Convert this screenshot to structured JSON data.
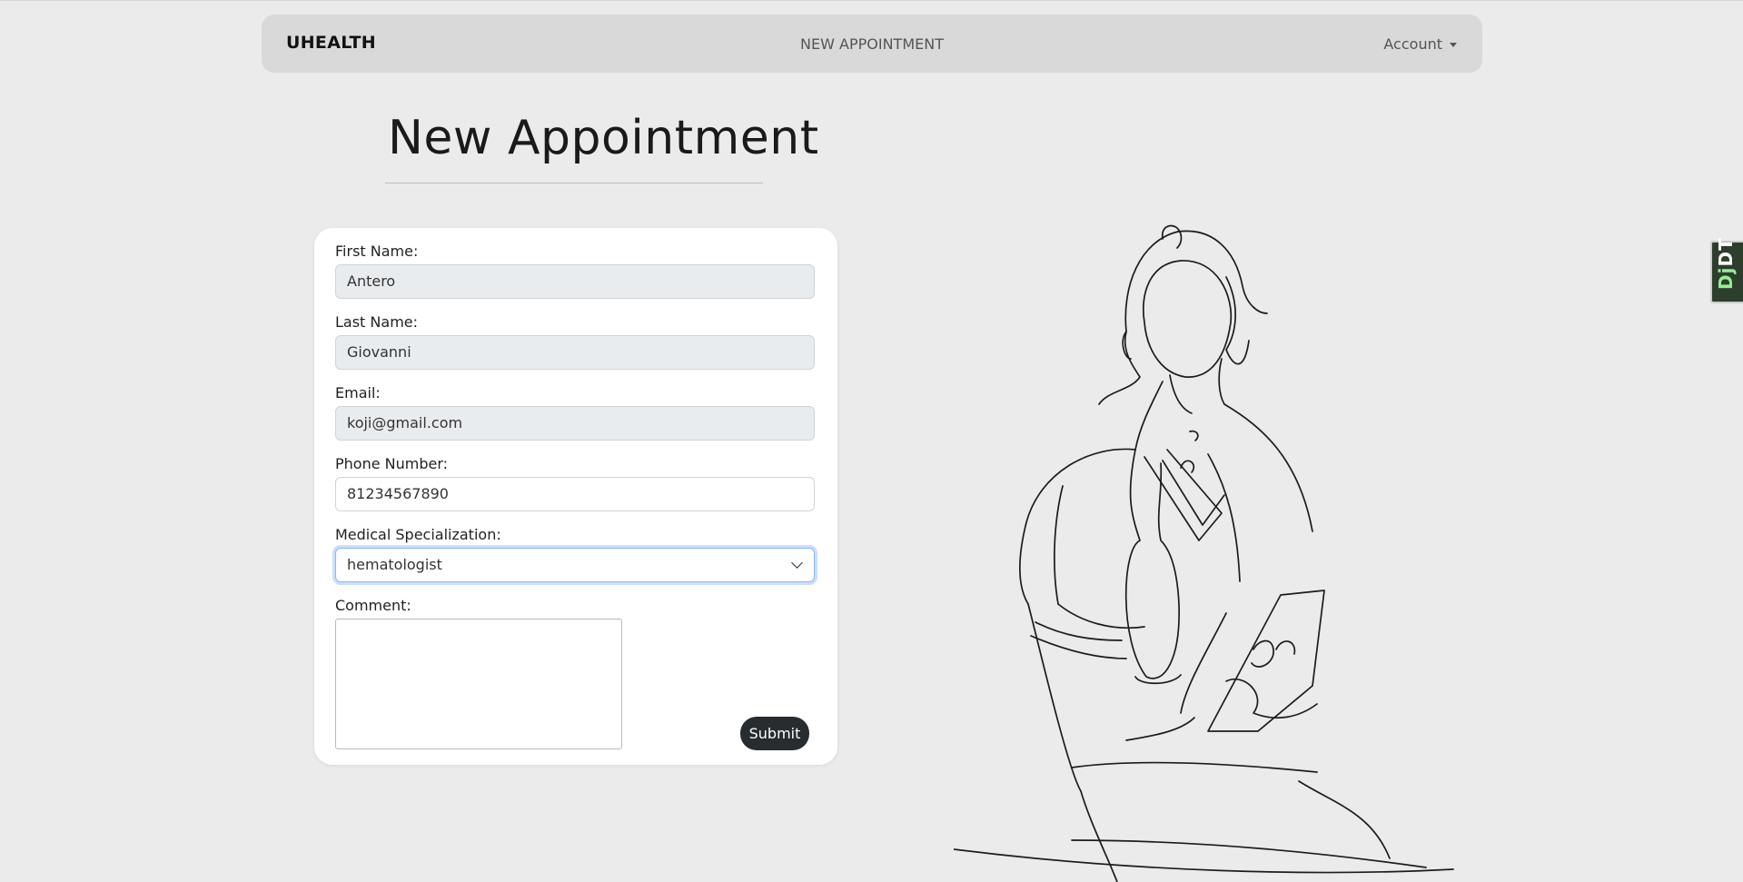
{
  "navbar": {
    "brand": "UHEALTH",
    "center_link": "NEW APPOINTMENT",
    "account_label": "Account"
  },
  "page": {
    "title": "New Appointment"
  },
  "form": {
    "first_name": {
      "label": "First Name:",
      "value": "Antero"
    },
    "last_name": {
      "label": "Last Name:",
      "value": "Giovanni"
    },
    "email": {
      "label": "Email:",
      "value": "koji@gmail.com"
    },
    "phone": {
      "label": "Phone Number:",
      "value": "81234567890"
    },
    "specialization": {
      "label": "Medical Specialization:",
      "selected": "hematologist"
    },
    "comment": {
      "label": "Comment:",
      "value": ""
    },
    "submit_label": "Submit"
  },
  "debug_toolbar": {
    "prefix": "Dj",
    "suffix": "DT"
  },
  "colors": {
    "background": "#ebebeb",
    "navbar": "#d9d9d9",
    "readonly_field": "#e9ecef",
    "submit_button": "#272c30",
    "focus_ring": "#86b7fe"
  }
}
